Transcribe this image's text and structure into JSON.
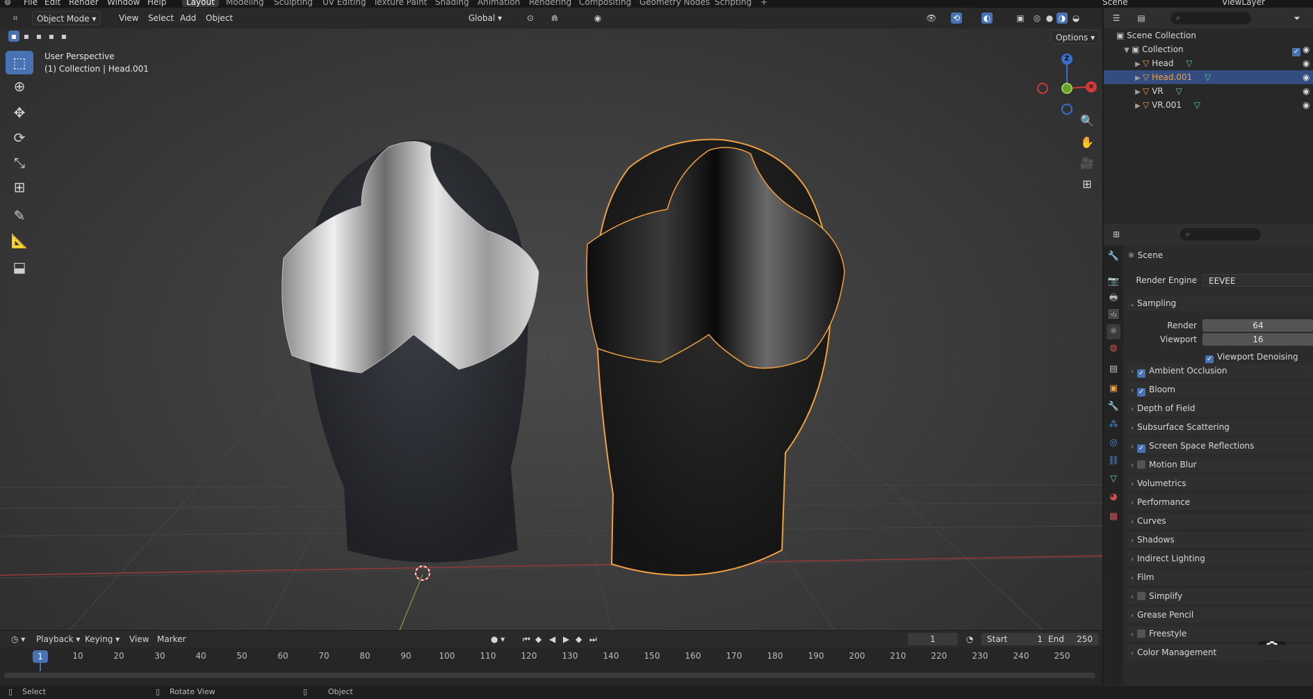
{
  "topbar": {
    "menus": [
      "File",
      "Edit",
      "Render",
      "Window",
      "Help"
    ],
    "workspaces": [
      {
        "label": "Layout",
        "active": true
      },
      {
        "label": "Modeling"
      },
      {
        "label": "Sculpting"
      },
      {
        "label": "UV Editing"
      },
      {
        "label": "Texture Paint"
      },
      {
        "label": "Shading"
      },
      {
        "label": "Animation"
      },
      {
        "label": "Rendering"
      },
      {
        "label": "Compositing"
      },
      {
        "label": "Geometry Nodes"
      },
      {
        "label": "Scripting"
      }
    ],
    "add_workspace": "+",
    "scene": "Scene",
    "view_layer": "ViewLayer"
  },
  "viewport_header": {
    "mode": "Object Mode",
    "menus": [
      "View",
      "Select",
      "Add",
      "Object"
    ],
    "orientation": "Global",
    "options": "Options"
  },
  "viewport": {
    "perspective": "User Perspective",
    "collection_info": "(1) Collection | Head.001",
    "gizmo": {
      "z": "Z",
      "y": "Y",
      "x": "X"
    }
  },
  "outliner": {
    "root": "Scene Collection",
    "collection": "Collection",
    "items": [
      {
        "name": "Head",
        "selected": false
      },
      {
        "name": "Head.001",
        "selected": true
      },
      {
        "name": "VR",
        "selected": false
      },
      {
        "name": "VR.001",
        "selected": false
      }
    ]
  },
  "properties": {
    "context": "Scene",
    "render_engine_label": "Render Engine",
    "render_engine_value": "EEVEE",
    "sampling": {
      "title": "Sampling",
      "render_label": "Render",
      "render_value": "64",
      "viewport_label": "Viewport",
      "viewport_value": "16",
      "denoise_label": "Viewport Denoising"
    },
    "panels": [
      {
        "label": "Ambient Occlusion",
        "checkbox": "on"
      },
      {
        "label": "Bloom",
        "checkbox": "on"
      },
      {
        "label": "Depth of Field",
        "checkbox": "none"
      },
      {
        "label": "Subsurface Scattering",
        "checkbox": "none"
      },
      {
        "label": "Screen Space Reflections",
        "checkbox": "on"
      },
      {
        "label": "Motion Blur",
        "checkbox": "off"
      },
      {
        "label": "Volumetrics",
        "checkbox": "none"
      },
      {
        "label": "Performance",
        "checkbox": "none"
      },
      {
        "label": "Curves",
        "checkbox": "none"
      },
      {
        "label": "Shadows",
        "checkbox": "none"
      },
      {
        "label": "Indirect Lighting",
        "checkbox": "none"
      },
      {
        "label": "Film",
        "checkbox": "none"
      },
      {
        "label": "Simplify",
        "checkbox": "off"
      },
      {
        "label": "Grease Pencil",
        "checkbox": "none"
      },
      {
        "label": "Freestyle",
        "checkbox": "off"
      },
      {
        "label": "Color Management",
        "checkbox": "none"
      }
    ]
  },
  "timeline": {
    "menus": [
      "Playback",
      "Keying",
      "View",
      "Marker"
    ],
    "current_frame": "1",
    "start_label": "Start",
    "start_value": "1",
    "end_label": "End",
    "end_value": "250",
    "ticks": [
      "10",
      "20",
      "30",
      "40",
      "50",
      "60",
      "70",
      "80",
      "90",
      "100",
      "110",
      "120",
      "130",
      "140",
      "150",
      "160",
      "170",
      "180",
      "190",
      "200",
      "210",
      "220",
      "230",
      "240",
      "250"
    ],
    "playhead": "1"
  },
  "statusbar": {
    "select": "Select",
    "rotate": "Rotate View",
    "object": "Object"
  },
  "colors": {
    "accent": "#4772b3",
    "selection_outline": "#f0a040",
    "outliner_selected": "#334d80"
  }
}
